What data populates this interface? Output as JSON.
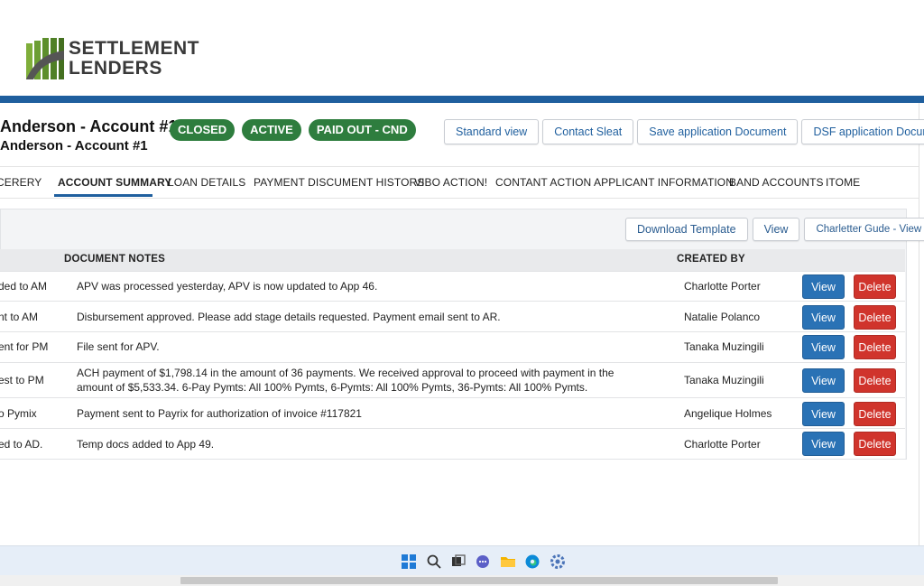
{
  "brand": {
    "line1": "SETTLEMENT",
    "line2": "LENDERS"
  },
  "account": {
    "title": "Anderson - Account #1",
    "subtitle": "Anderson - Account #1",
    "badges": [
      "CLOSED",
      "ACTIVE",
      "PAID OUT - CND"
    ]
  },
  "top_actions": [
    "Standard view",
    "Contact Sleat",
    "Save application Document",
    "DSF application Document"
  ],
  "tabs": [
    "CERERY",
    "ACCOUNT SUMMARY",
    "LOAN DETAILS",
    "PAYMENT DISCUMENT HISTORS",
    "VIBO ACTION!",
    "CONTANT ACTION",
    "APPLICANT INFORMATION",
    "BAND ACCOUNTS",
    "ITOME"
  ],
  "active_tab": "ACCOUNT SUMMARY",
  "toolbar": [
    "Download Template",
    "View",
    "Charletter Gude - View"
  ],
  "table": {
    "headers": {
      "notes": "DOCUMENT NOTES",
      "created_by": "CREATED BY"
    },
    "rows": [
      {
        "left": "ded to AM",
        "note": "APV was processed yesterday, APV is now updated to App 46.",
        "creator": "Charlotte Porter"
      },
      {
        "left": "nt to AM",
        "note": "Disbursement approved. Please add stage details requested. Payment email sent to AR.",
        "creator": "Natalie Polanco"
      },
      {
        "left": "ent for PM",
        "note": "File sent for APV.",
        "creator": "Tanaka Muzingili"
      },
      {
        "left": "est to PM",
        "note": "ACH payment of $1,798.14 in the amount of 36 payments. We received approval to proceed with payment in the amount of $5,533.34. 6-Pay Pymts: All 100% Pymts, 6-Pymts: All 100% Pymts, 36-Pymts: All 100% Pymts.",
        "creator": "Tanaka Muzingili"
      },
      {
        "left": "o Pymix",
        "note": "Payment sent to Payrix for authorization of invoice #117821",
        "creator": "Angelique Holmes"
      },
      {
        "left": "ed to AD.",
        "note": "Temp docs added to App 49.",
        "creator": "Charlotte Porter"
      }
    ],
    "view_label": "View",
    "delete_label": "Delete"
  },
  "colors": {
    "accent": "#1f5f9e",
    "badge_green": "#2e7d3e",
    "view_blue": "#2a72b5",
    "delete_red": "#d0342c"
  },
  "taskbar_icons": [
    "windows-start-icon",
    "search-icon",
    "task-view-icon",
    "chat-icon",
    "file-explorer-icon",
    "edge-browser-icon",
    "settings-icon"
  ]
}
